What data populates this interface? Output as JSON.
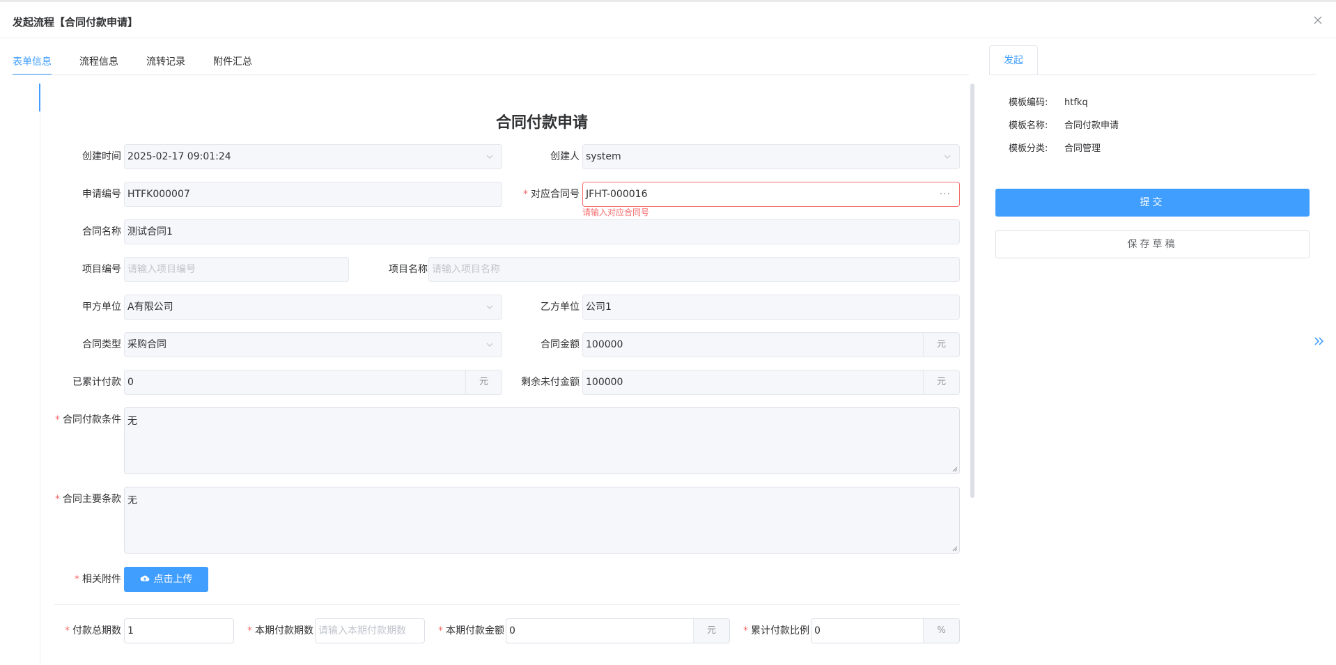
{
  "header": {
    "title": "发起流程【合同付款申请】"
  },
  "tabs": [
    {
      "label": "表单信息"
    },
    {
      "label": "流程信息"
    },
    {
      "label": "流转记录"
    },
    {
      "label": "附件汇总"
    }
  ],
  "form": {
    "title": "合同付款申请",
    "created_time": {
      "label": "创建时间",
      "value": "2025-02-17 09:01:24"
    },
    "creator": {
      "label": "创建人",
      "value": "system"
    },
    "apply_no": {
      "label": "申请编号",
      "value": "HTFK000007"
    },
    "contract_no": {
      "label": "对应合同号",
      "value": "JFHT-000016",
      "error": "请输入对应合同号"
    },
    "contract_name": {
      "label": "合同名称",
      "value": "测试合同1"
    },
    "project_no": {
      "label": "项目编号",
      "placeholder": "请输入项目编号"
    },
    "project_name": {
      "label": "项目名称",
      "placeholder": "请输入项目名称"
    },
    "party_a": {
      "label": "甲方单位",
      "value": "A有限公司"
    },
    "party_b": {
      "label": "乙方单位",
      "value": "公司1"
    },
    "contract_type": {
      "label": "合同类型",
      "value": "采购合同"
    },
    "contract_amount": {
      "label": "合同金额",
      "value": "100000",
      "unit": "元"
    },
    "paid_total": {
      "label": "已累计付款",
      "value": "0",
      "unit": "元"
    },
    "remaining": {
      "label": "剩余未付金额",
      "value": "100000",
      "unit": "元"
    },
    "payment_terms": {
      "label": "合同付款条件",
      "value": "无"
    },
    "main_terms": {
      "label": "合同主要条款",
      "value": "无"
    },
    "attachments": {
      "label": "相关附件",
      "button": "点击上传"
    },
    "total_periods": {
      "label": "付款总期数",
      "value": "1"
    },
    "current_period": {
      "label": "本期付款期数",
      "placeholder": "请输入本期付款期数"
    },
    "current_amount": {
      "label": "本期付款金额",
      "value": "0",
      "unit": "元"
    },
    "cumulative_ratio": {
      "label": "累计付款比例",
      "value": "0",
      "unit": "%"
    }
  },
  "right_panel": {
    "tab": "发起",
    "template_code": {
      "label": "模板编码:",
      "value": "htfkq"
    },
    "template_name": {
      "label": "模板名称:",
      "value": "合同付款申请"
    },
    "template_category": {
      "label": "模板分类:",
      "value": "合同管理"
    },
    "submit": "提交",
    "save_draft": "保存草稿"
  },
  "colors": {
    "primary": "#409eff",
    "danger": "#f56c6c"
  }
}
